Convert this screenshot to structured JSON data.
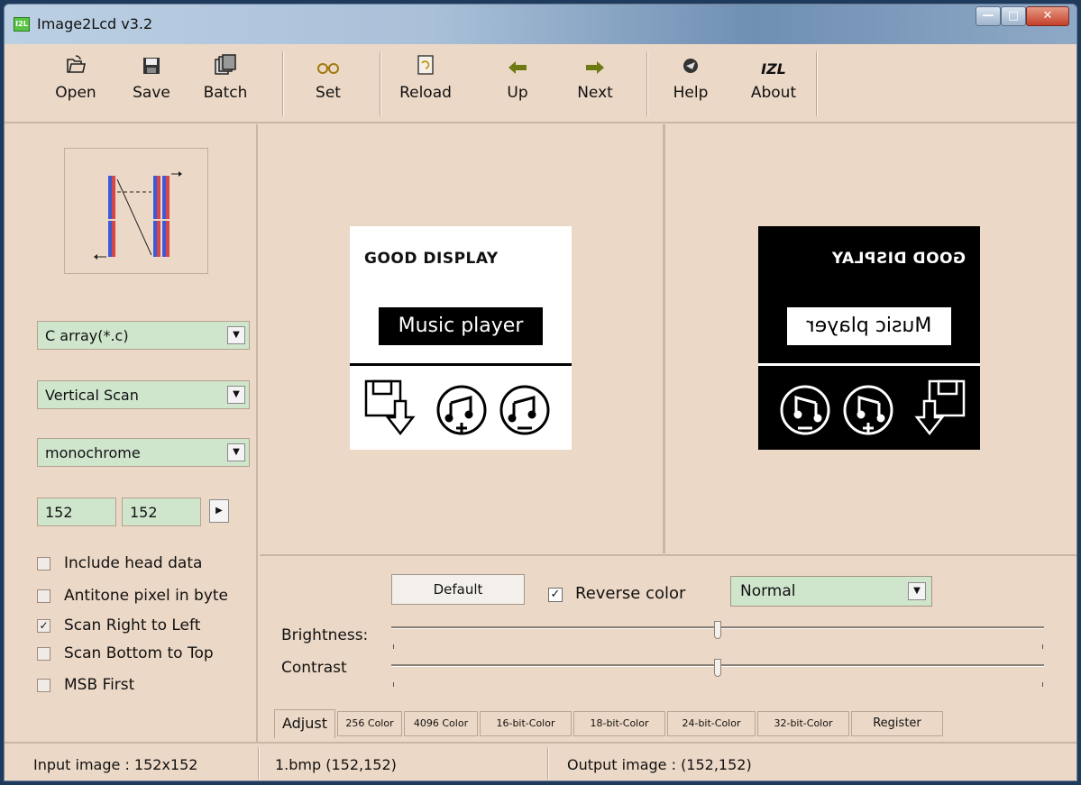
{
  "window": {
    "title": "Image2Lcd v3.2",
    "icon_text": "I2L"
  },
  "toolbar": {
    "buttons": [
      {
        "label": "Open",
        "icon": "open-folder-icon"
      },
      {
        "label": "Save",
        "icon": "floppy-disk-icon"
      },
      {
        "label": "Batch",
        "icon": "batch-pages-icon"
      },
      {
        "label": "Set",
        "icon": "glasses-icon"
      },
      {
        "label": "Reload",
        "icon": "reload-icon"
      },
      {
        "label": "Up",
        "icon": "arrow-left-icon"
      },
      {
        "label": "Next",
        "icon": "arrow-right-icon"
      },
      {
        "label": "Help",
        "icon": "help-icon"
      },
      {
        "label": "About",
        "icon": "izl-logo-icon",
        "icon_text": "IZL"
      }
    ]
  },
  "left": {
    "output_format": "C array(*.c)",
    "scan_mode": "Vertical Scan",
    "color_mode": "monochrome",
    "width": "152",
    "height": "152",
    "checkboxes": [
      {
        "label": "Include head data",
        "checked": false
      },
      {
        "label": "Antitone pixel in byte",
        "checked": false
      },
      {
        "label": "Scan Right to Left",
        "checked": true
      },
      {
        "label": "Scan Bottom to Top",
        "checked": false
      },
      {
        "label": "MSB First",
        "checked": false
      }
    ]
  },
  "preview": {
    "heading": "GOOD DISPLAY",
    "label": "Music player"
  },
  "adjust": {
    "default_label": "Default",
    "reverse_color_label": "Reverse color",
    "reverse_color_checked": true,
    "mode": "Normal",
    "brightness_label": "Brightness:",
    "contrast_label": "Contrast",
    "brightness_value": 0.5,
    "contrast_value": 0.5
  },
  "tabs": [
    "Adjust",
    "256 Color",
    "4096 Color",
    "16-bit-Color",
    "18-bit-Color",
    "24-bit-Color",
    "32-bit-Color",
    "Register"
  ],
  "status": {
    "input": "Input image : 152x152",
    "file": "1.bmp (152,152)",
    "output": "Output image : (152,152)"
  },
  "colors": {
    "window_bg": "#ecd8c6",
    "field_bg": "#cfe6cd"
  }
}
